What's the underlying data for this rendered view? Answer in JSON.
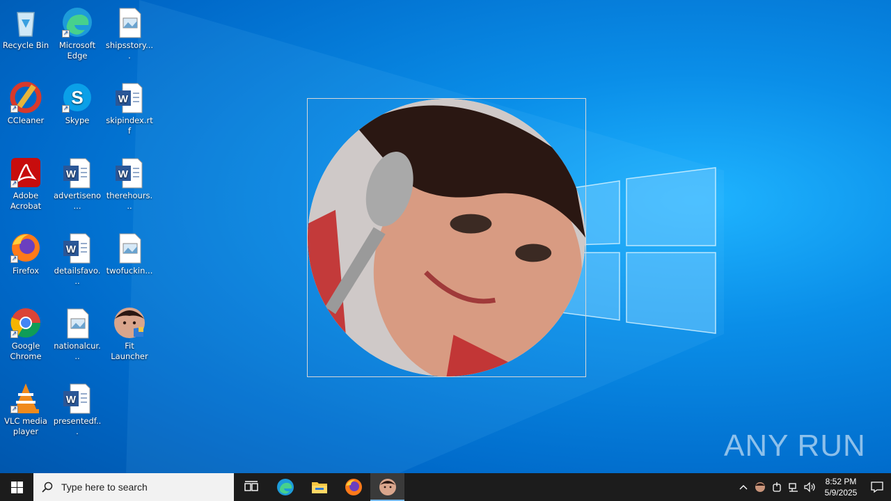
{
  "desktop": {
    "icons": [
      {
        "label": "Recycle Bin",
        "icon": "recycle-bin-icon"
      },
      {
        "label": "Microsoft Edge",
        "icon": "edge-icon"
      },
      {
        "label": "shipsstory....",
        "icon": "image-file-icon"
      },
      {
        "label": "CCleaner",
        "icon": "ccleaner-icon"
      },
      {
        "label": "Skype",
        "icon": "skype-icon"
      },
      {
        "label": "skipindex.rtf",
        "icon": "word-doc-icon"
      },
      {
        "label": "Adobe Acrobat",
        "icon": "acrobat-icon"
      },
      {
        "label": "advertiseno...",
        "icon": "word-doc-icon"
      },
      {
        "label": "therehours...",
        "icon": "word-doc-icon"
      },
      {
        "label": "Firefox",
        "icon": "firefox-icon"
      },
      {
        "label": "detailsfavo...",
        "icon": "word-doc-icon"
      },
      {
        "label": "twofuckin...",
        "icon": "image-file-icon"
      },
      {
        "label": "Google Chrome",
        "icon": "chrome-icon"
      },
      {
        "label": "nationalcur...",
        "icon": "image-file-icon"
      },
      {
        "label": "Fit Launcher",
        "icon": "fit-launcher-icon"
      },
      {
        "label": "VLC media player",
        "icon": "vlc-icon"
      },
      {
        "label": "presentedf...",
        "icon": "word-doc-icon"
      }
    ]
  },
  "viewer": {
    "content": "circular-portrait-image"
  },
  "watermark": {
    "left": "ANY",
    "right": "RUN"
  },
  "taskbar": {
    "search_placeholder": "Type here to search",
    "pinned": [
      "task-view-icon",
      "edge-icon",
      "file-explorer-icon",
      "firefox-icon",
      "fit-launcher-icon"
    ],
    "clock": {
      "time": "8:52 PM",
      "date": "5/9/2025"
    }
  },
  "colors": {
    "desktop": "#0a8ee8",
    "taskbar": "#1c1c1c",
    "accent": "#76b9ed"
  }
}
